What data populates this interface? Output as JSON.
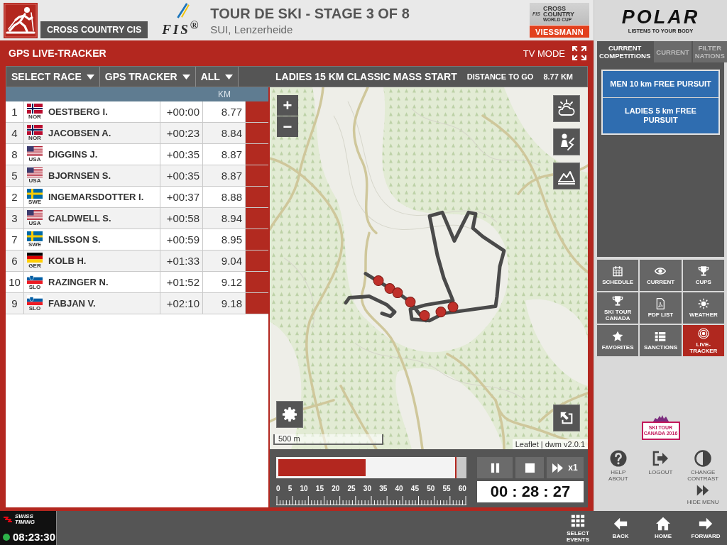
{
  "header": {
    "section": "CROSS COUNTRY CIS",
    "fis_logo": "FIS$^{®}$",
    "title": "TOUR DE SKI - STAGE 3 OF 8",
    "location": "SUI, Lenzerheide",
    "cup_logo": {
      "mark": "FIS",
      "lines": [
        "CROSS COUNTRY",
        "WORLD CUP"
      ],
      "sponsor": "VIESSMANN"
    }
  },
  "tracker": {
    "title": "GPS LIVE-TRACKER",
    "tv_mode": "TV MODE"
  },
  "toolbar": {
    "dropdowns": [
      "SELECT RACE",
      "GPS TRACKER",
      "ALL"
    ],
    "race": "LADIES 15 KM CLASSIC MASS START",
    "distance_label": "DISTANCE TO GO",
    "distance": "8.77 KM"
  },
  "table": {
    "km_heading": "KM",
    "rows": [
      {
        "bib": "1",
        "kind": "norway",
        "nation": "NOR",
        "name": "OESTBERG I.",
        "gap": "+00:00",
        "km": "8.77"
      },
      {
        "bib": "4",
        "kind": "norway",
        "nation": "NOR",
        "name": "JACOBSEN A.",
        "gap": "+00:23",
        "km": "8.84"
      },
      {
        "bib": "8",
        "kind": "usa",
        "nation": "USA",
        "name": "DIGGINS J.",
        "gap": "+00:35",
        "km": "8.87"
      },
      {
        "bib": "5",
        "kind": "usa",
        "nation": "USA",
        "name": "BJORNSEN S.",
        "gap": "+00:35",
        "km": "8.87"
      },
      {
        "bib": "2",
        "kind": "sweden",
        "nation": "SWE",
        "name": "INGEMARSDOTTER I.",
        "gap": "+00:37",
        "km": "8.88"
      },
      {
        "bib": "3",
        "kind": "usa",
        "nation": "USA",
        "name": "CALDWELL S.",
        "gap": "+00:58",
        "km": "8.94"
      },
      {
        "bib": "7",
        "kind": "sweden",
        "nation": "SWE",
        "name": "NILSSON S.",
        "gap": "+00:59",
        "km": "8.95"
      },
      {
        "bib": "6",
        "kind": "germany",
        "nation": "GER",
        "name": "KOLB H.",
        "gap": "+01:33",
        "km": "9.04"
      },
      {
        "bib": "10",
        "kind": "slovenia",
        "nation": "SLO",
        "name": "RAZINGER N.",
        "gap": "+01:52",
        "km": "9.12"
      },
      {
        "bib": "9",
        "kind": "slovenia",
        "nation": "SLO",
        "name": "FABJAN V.",
        "gap": "+02:10",
        "km": "9.18"
      }
    ]
  },
  "map": {
    "zoom_in": "+",
    "zoom_out": "−",
    "scale": "500 m",
    "attribution": "Leaflet | dwm v2.0.1"
  },
  "playback": {
    "progress": {
      "level": 0.47
    },
    "live_marker": {
      "level": 0.94
    },
    "ticks": [
      "0",
      "5",
      "10",
      "15",
      "20",
      "25",
      "30",
      "35",
      "40",
      "45",
      "50",
      "55",
      "60"
    ],
    "speed": "x1",
    "time": "00 : 28 : 27"
  },
  "sidebar": {
    "logo": {
      "brand": "POLAR",
      "slogan": "LISTENS TO YOUR BODY"
    },
    "tabs": [
      {
        "label": "CURRENT COMPETITIONS",
        "selected": true
      },
      {
        "label": "CURRENT",
        "selected": false
      },
      {
        "label": "FILTER NATIONS",
        "selected": false
      }
    ],
    "competitions": [
      "MEN 10 km FREE PURSUIT",
      "LADIES 5 km FREE PURSUIT"
    ],
    "menu": [
      {
        "label": "SCHEDULE",
        "selected": false
      },
      {
        "label": "CURRENT",
        "selected": false
      },
      {
        "label": "CUPS",
        "selected": false
      },
      {
        "label": "SKI TOUR CANADA",
        "selected": false
      },
      {
        "label": "PDF LIST",
        "selected": false
      },
      {
        "label": "WEATHER",
        "selected": false
      },
      {
        "label": "FAVORITES",
        "selected": false
      },
      {
        "label": "SANCTIONS",
        "selected": false
      },
      {
        "label": "LIVE-TRACKER",
        "selected": true
      }
    ],
    "event_logo": "SKI TOUR CANADA 2016",
    "actions": [
      "HELP ABOUT",
      "LOGOUT",
      "CHANGE CONTRAST",
      "HIDE MENU"
    ]
  },
  "bottom_bar": {
    "clock": {
      "brand": "SWISS TIMING",
      "connected": true,
      "time": "08:23:30"
    },
    "nav": [
      "SELECT EVENTS",
      "BACK",
      "HOME",
      "FORWARD"
    ]
  }
}
